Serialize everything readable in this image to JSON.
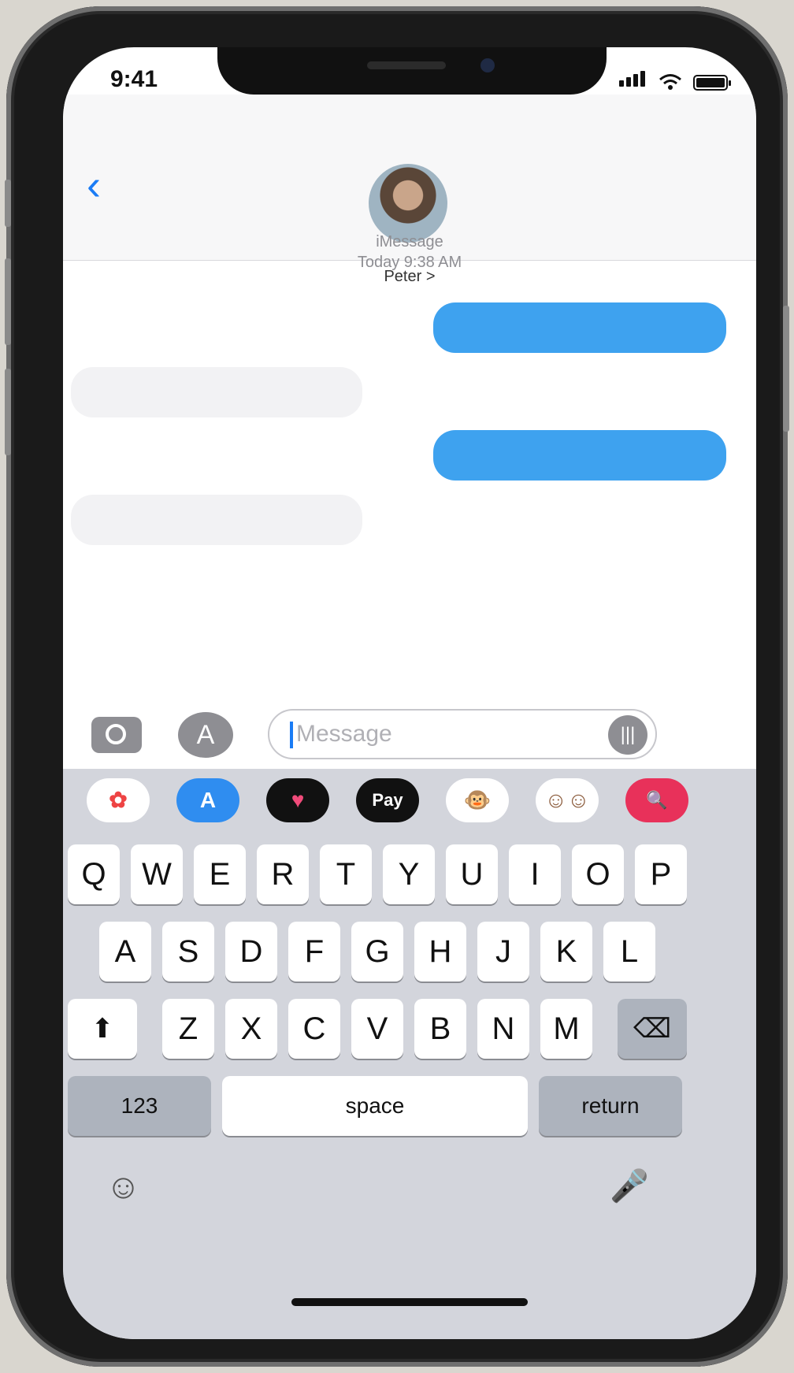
{
  "status_bar": {
    "time": "9:41"
  },
  "header": {
    "back_icon": "chevron-left-icon",
    "contact_name": "Peter >"
  },
  "conversation": {
    "service": "iMessage",
    "timestamp": "Today 9:38 AM",
    "bubbles": [
      {
        "side": "outgoing",
        "color": "#3ea2ef"
      },
      {
        "side": "incoming",
        "color": "#f2f2f4"
      },
      {
        "side": "outgoing",
        "color": "#3ea2ef"
      },
      {
        "side": "incoming",
        "color": "#f2f2f4"
      }
    ]
  },
  "composer": {
    "camera_icon": "camera-icon",
    "apps_icon": "app-store-icon",
    "placeholder": "Message",
    "audio_icon": "audio-waveform-icon"
  },
  "app_strip": [
    {
      "name": "photos-app-icon",
      "label": ""
    },
    {
      "name": "app-store-app-icon",
      "label": "A"
    },
    {
      "name": "digital-touch-app-icon",
      "label": "♥"
    },
    {
      "name": "apple-pay-app-icon",
      "label": "Pay"
    },
    {
      "name": "animoji-app-icon",
      "label": "🐵"
    },
    {
      "name": "memoji-app-icon",
      "label": ""
    },
    {
      "name": "images-search-app-icon",
      "label": "🔍"
    }
  ],
  "keyboard": {
    "row1": [
      "Q",
      "W",
      "E",
      "R",
      "T",
      "Y",
      "U",
      "I",
      "O",
      "P"
    ],
    "row2": [
      "A",
      "S",
      "D",
      "F",
      "G",
      "H",
      "J",
      "K",
      "L"
    ],
    "row3": [
      "Z",
      "X",
      "C",
      "V",
      "B",
      "N",
      "M"
    ],
    "shift": "⬆",
    "delete": "⌫",
    "numbers": "123",
    "space": "space",
    "return": "return",
    "emoji_icon": "☺",
    "mic_icon": "🎤"
  },
  "colors": {
    "accent": "#1a7cf5",
    "outgoing_bubble": "#3ea2ef",
    "incoming_bubble": "#f2f2f4"
  }
}
